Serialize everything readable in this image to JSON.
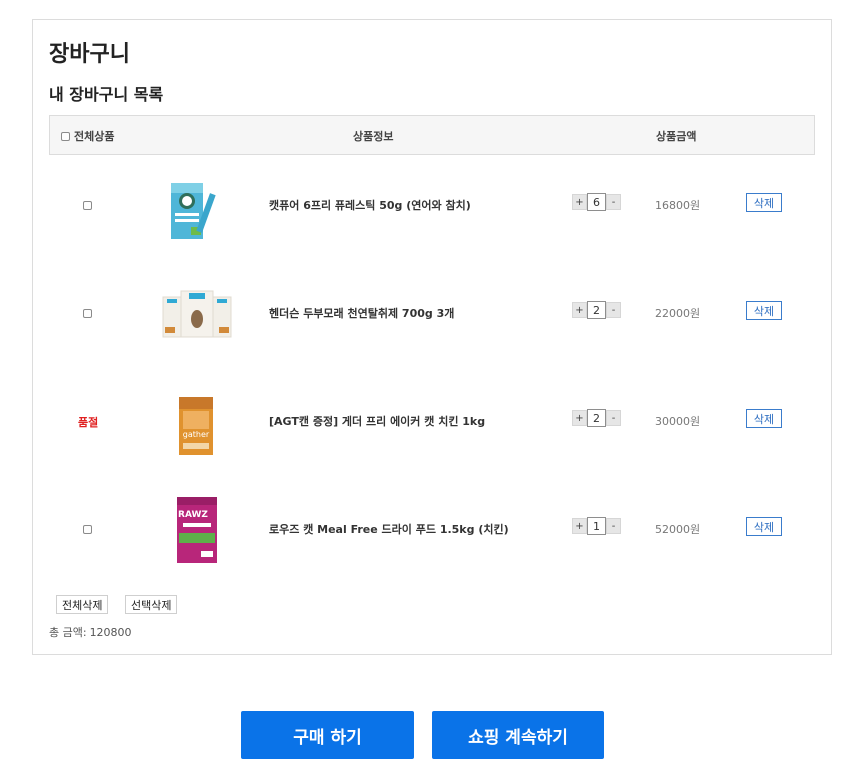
{
  "cart": {
    "title": "장바구니",
    "subtitle": "내 장바구니 목록",
    "header": {
      "select_all": "전체상품",
      "product_info": "상품정보",
      "product_price": "상품금액"
    },
    "items": [
      {
        "status": "",
        "name": "캣퓨어 6프리 퓨레스틱 50g (연어와 참치)",
        "qty": "6",
        "plus": "+",
        "minus": "-",
        "price": "16800원",
        "delete_label": "삭제",
        "image_colors": {
          "bag": "#4fb6d8",
          "accent": "#ffffff"
        }
      },
      {
        "status": "",
        "name": "헨더슨 두부모래 천연탈취제 700g 3개",
        "qty": "2",
        "plus": "+",
        "minus": "-",
        "price": "22000원",
        "delete_label": "삭제",
        "image_colors": {
          "bag": "#f2efe8",
          "accent": "#30a9d4"
        }
      },
      {
        "status": "품절",
        "name": "[AGT캔 증정] 게더 프리 에이커 캣 치킨 1kg",
        "qty": "2",
        "plus": "+",
        "minus": "-",
        "price": "30000원",
        "delete_label": "삭제",
        "image_colors": {
          "bag": "#e0922e",
          "accent": "#ffffff"
        }
      },
      {
        "status": "",
        "name": "로우즈 캣 Meal Free 드라이 푸드 1.5kg (치킨)",
        "qty": "1",
        "plus": "+",
        "minus": "-",
        "price": "52000원",
        "delete_label": "삭제",
        "image_colors": {
          "bag": "#b8267a",
          "accent": "#5db04a"
        }
      }
    ],
    "delete_all_label": "전체삭제",
    "delete_selected_label": "선택삭제",
    "total_label": "총 금액:",
    "total_value": "120800"
  },
  "actions": {
    "buy_label": "구매 하기",
    "continue_label": "쇼핑 계속하기"
  },
  "colors": {
    "primary": "#0a73e8",
    "sold_out": "#e02020",
    "delete_border": "#3a7ccc"
  }
}
